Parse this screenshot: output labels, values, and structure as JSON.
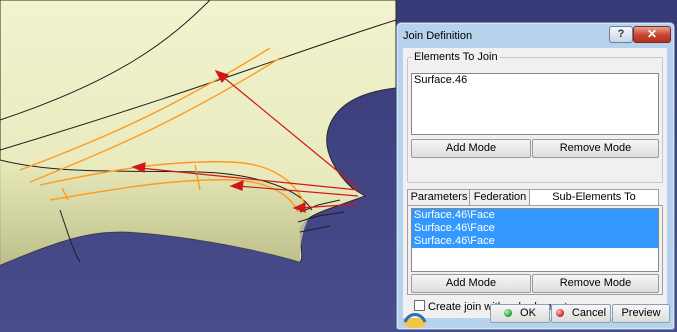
{
  "dialog": {
    "title": "Join Definition",
    "help_label": "?",
    "close_label": "✕",
    "elements_group_label": "Elements To Join",
    "elements": [
      "Surface.46"
    ],
    "add_mode_label": "Add Mode",
    "remove_mode_label": "Remove Mode",
    "tabs": [
      {
        "label": "Parameters",
        "active": false
      },
      {
        "label": "Federation",
        "active": false
      },
      {
        "label": "Sub-Elements To Remove",
        "active": true
      }
    ],
    "sub_elements": [
      "Surface.46\\Face",
      "Surface.46\\Face",
      "Surface.46\\Face"
    ],
    "sub_add_mode_label": "Add Mode",
    "sub_remove_mode_label": "Remove Mode",
    "checkbox_label": "Create join with sub-elements",
    "checkbox_checked": false,
    "ok_label": "OK",
    "cancel_label": "Cancel",
    "preview_label": "Preview"
  },
  "colors": {
    "background_model": "#3c3f7c",
    "surface": "#eef0c4",
    "highlight_edges": "#ff9a1e",
    "arrows": "#d01818",
    "selection": "#3399ff",
    "dialog_frame": "#b7d2ec"
  },
  "icons": [
    "help-icon",
    "close-icon",
    "ok-led-icon",
    "cancel-led-icon",
    "app-logo-icon"
  ]
}
